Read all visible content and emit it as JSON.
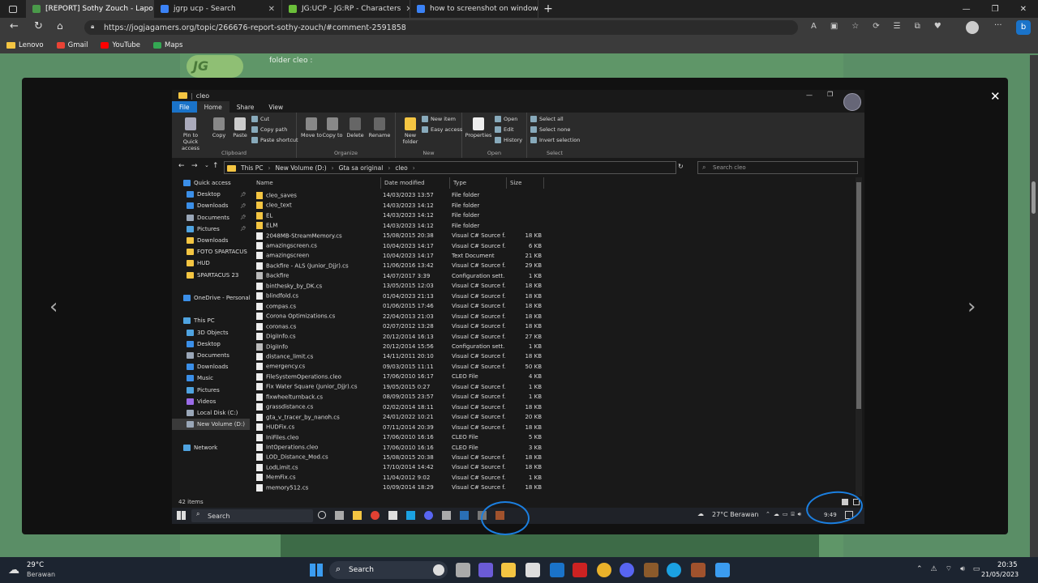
{
  "browser": {
    "tabs": [
      {
        "title": "[REPORT] Sothy Zouch - Laporan",
        "active": true,
        "color": "#4a9a4a"
      },
      {
        "title": "jgrp ucp - Search",
        "active": false,
        "color": "#3b82f6"
      },
      {
        "title": "JG:UCP - JG:RP - Characters",
        "active": false,
        "color": "#6bbf3a"
      },
      {
        "title": "how to screenshot on windows -",
        "active": false,
        "color": "#3b82f6"
      }
    ],
    "url": "https://jogjagamers.org/topic/266676-report-sothy-zouch/#comment-2591858",
    "favorites": [
      "Lenovo",
      "Gmail",
      "YouTube",
      "Maps"
    ],
    "page_text": "folder cleo :",
    "site_logo": "JG"
  },
  "explorer": {
    "title": "cleo",
    "ribbon_tabs": [
      "File",
      "Home",
      "Share",
      "View"
    ],
    "clipboard": {
      "pin": "Pin to Quick access",
      "copy": "Copy",
      "paste": "Paste",
      "cut": "Cut",
      "copy_path": "Copy path",
      "paste_shortcut": "Paste shortcut",
      "label": "Clipboard"
    },
    "organize": {
      "move": "Move to",
      "copy": "Copy to",
      "delete": "Delete",
      "rename": "Rename",
      "label": "Organize"
    },
    "new": {
      "folder": "New folder",
      "item": "New item",
      "easy": "Easy access",
      "label": "New"
    },
    "open": {
      "properties": "Properties",
      "open": "Open",
      "edit": "Edit",
      "history": "History",
      "label": "Open"
    },
    "select": {
      "all": "Select all",
      "none": "Select none",
      "invert": "Invert selection",
      "label": "Select"
    },
    "breadcrumb": [
      "This PC",
      "New Volume (D:)",
      "Gta sa original",
      "cleo"
    ],
    "search_placeholder": "Search cleo",
    "nav": [
      {
        "label": "Quick access",
        "color": "#3b8fe8",
        "indent": 0
      },
      {
        "label": "Desktop",
        "color": "#3b8fe8",
        "indent": 1,
        "pin": true
      },
      {
        "label": "Downloads",
        "color": "#3b8fe8",
        "indent": 1,
        "pin": true
      },
      {
        "label": "Documents",
        "color": "#9aa7b8",
        "indent": 1,
        "pin": true
      },
      {
        "label": "Pictures",
        "color": "#4fa3e0",
        "indent": 1,
        "pin": true
      },
      {
        "label": "Downloads",
        "color": "#f4c542",
        "indent": 1
      },
      {
        "label": "FOTO SPARTACUS",
        "color": "#f4c542",
        "indent": 1
      },
      {
        "label": "HUD",
        "color": "#f4c542",
        "indent": 1
      },
      {
        "label": "SPARTACUS 23",
        "color": "#f4c542",
        "indent": 1
      },
      {
        "label": "",
        "color": "",
        "indent": 0
      },
      {
        "label": "OneDrive - Personal",
        "color": "#3b8fe8",
        "indent": 0
      },
      {
        "label": "",
        "color": "",
        "indent": 0
      },
      {
        "label": "This PC",
        "color": "#4fa3e0",
        "indent": 0
      },
      {
        "label": "3D Objects",
        "color": "#4fa3e0",
        "indent": 1
      },
      {
        "label": "Desktop",
        "color": "#3b8fe8",
        "indent": 1
      },
      {
        "label": "Documents",
        "color": "#9aa7b8",
        "indent": 1
      },
      {
        "label": "Downloads",
        "color": "#3b8fe8",
        "indent": 1
      },
      {
        "label": "Music",
        "color": "#3b8fe8",
        "indent": 1
      },
      {
        "label": "Pictures",
        "color": "#4fa3e0",
        "indent": 1
      },
      {
        "label": "Videos",
        "color": "#9b6be8",
        "indent": 1
      },
      {
        "label": "Local Disk (C:)",
        "color": "#9aa7b8",
        "indent": 1
      },
      {
        "label": "New Volume (D:)",
        "color": "#9aa7b8",
        "indent": 1,
        "selected": true
      },
      {
        "label": "",
        "color": "",
        "indent": 0
      },
      {
        "label": "Network",
        "color": "#4fa3e0",
        "indent": 0
      }
    ],
    "columns": [
      "Name",
      "Date modified",
      "Type",
      "Size"
    ],
    "files": [
      [
        "cleo_saves",
        "14/03/2023 13:57",
        "File folder",
        "",
        "folder"
      ],
      [
        "cleo_text",
        "14/03/2023 14:12",
        "File folder",
        "",
        "folder"
      ],
      [
        "EL",
        "14/03/2023 14:12",
        "File folder",
        "",
        "folder"
      ],
      [
        "ELM",
        "14/03/2023 14:12",
        "File folder",
        "",
        "folder"
      ],
      [
        "2048MB-StreamMemory.cs",
        "15/08/2015 20:38",
        "Visual C# Source f...",
        "18 KB",
        "file"
      ],
      [
        "amazingscreen.cs",
        "10/04/2023 14:17",
        "Visual C# Source f...",
        "6 KB",
        "file"
      ],
      [
        "amazingscreen",
        "10/04/2023 14:17",
        "Text Document",
        "21 KB",
        "file"
      ],
      [
        "Backfire - ALS (Junior_Djjr).cs",
        "11/06/2016 13:42",
        "Visual C# Source f...",
        "29 KB",
        "file"
      ],
      [
        "Backfire",
        "14/07/2017 3:39",
        "Configuration sett...",
        "1 KB",
        "cfg"
      ],
      [
        "binthesky_by_DK.cs",
        "13/05/2015 12:03",
        "Visual C# Source f...",
        "18 KB",
        "file"
      ],
      [
        "blindfold.cs",
        "01/04/2023 21:13",
        "Visual C# Source f...",
        "18 KB",
        "file"
      ],
      [
        "compas.cs",
        "01/06/2015 17:46",
        "Visual C# Source f...",
        "18 KB",
        "file"
      ],
      [
        "Corona Optimizations.cs",
        "22/04/2013 21:03",
        "Visual C# Source f...",
        "18 KB",
        "file"
      ],
      [
        "coronas.cs",
        "02/07/2012 13:28",
        "Visual C# Source f...",
        "18 KB",
        "file"
      ],
      [
        "DigiInfo.cs",
        "20/12/2014 16:13",
        "Visual C# Source f...",
        "27 KB",
        "file"
      ],
      [
        "DigiInfo",
        "20/12/2014 15:56",
        "Configuration sett...",
        "1 KB",
        "cfg"
      ],
      [
        "distance_limit.cs",
        "14/11/2011 20:10",
        "Visual C# Source f...",
        "18 KB",
        "file"
      ],
      [
        "emergency.cs",
        "09/03/2015 11:11",
        "Visual C# Source f...",
        "50 KB",
        "file"
      ],
      [
        "FileSystemOperations.cleo",
        "17/06/2010 16:17",
        "CLEO File",
        "4 KB",
        "file"
      ],
      [
        "Fix Water Square (Junior_Djjr).cs",
        "19/05/2015 0:27",
        "Visual C# Source f...",
        "1 KB",
        "file"
      ],
      [
        "fixwheelturnback.cs",
        "08/09/2015 23:57",
        "Visual C# Source f...",
        "1 KB",
        "file"
      ],
      [
        "grassdistance.cs",
        "02/02/2014 18:11",
        "Visual C# Source f...",
        "18 KB",
        "file"
      ],
      [
        "gta_v_tracer_by_nanoh.cs",
        "24/01/2022 10:21",
        "Visual C# Source f...",
        "20 KB",
        "file"
      ],
      [
        "HUDFix.cs",
        "07/11/2014 20:39",
        "Visual C# Source f...",
        "18 KB",
        "file"
      ],
      [
        "IniFiles.cleo",
        "17/06/2010 16:16",
        "CLEO File",
        "5 KB",
        "file"
      ],
      [
        "IntOperations.cleo",
        "17/06/2010 16:16",
        "CLEO File",
        "3 KB",
        "file"
      ],
      [
        "LOD_Distance_Mod.cs",
        "15/08/2015 20:38",
        "Visual C# Source f...",
        "18 KB",
        "file"
      ],
      [
        "LodLimit.cs",
        "17/10/2014 14:42",
        "Visual C# Source f...",
        "18 KB",
        "file"
      ],
      [
        "MemFix.cs",
        "11/04/2012 9:02",
        "Visual C# Source f...",
        "1 KB",
        "file"
      ],
      [
        "memory512.cs",
        "10/09/2014 18:29",
        "Visual C# Source f...",
        "18 KB",
        "file"
      ]
    ],
    "status": "42 items"
  },
  "inner_taskbar": {
    "search": "Search",
    "weather": "27°C  Berawan",
    "time": "9:49"
  },
  "os_taskbar": {
    "weather_temp": "29°C",
    "weather_desc": "Berawan",
    "search": "Search",
    "time": "20:35",
    "date": "21/05/2023"
  },
  "colors": {
    "folder": "#f4c542",
    "accent": "#1a73c9",
    "annotation": "#1b7fe0"
  }
}
